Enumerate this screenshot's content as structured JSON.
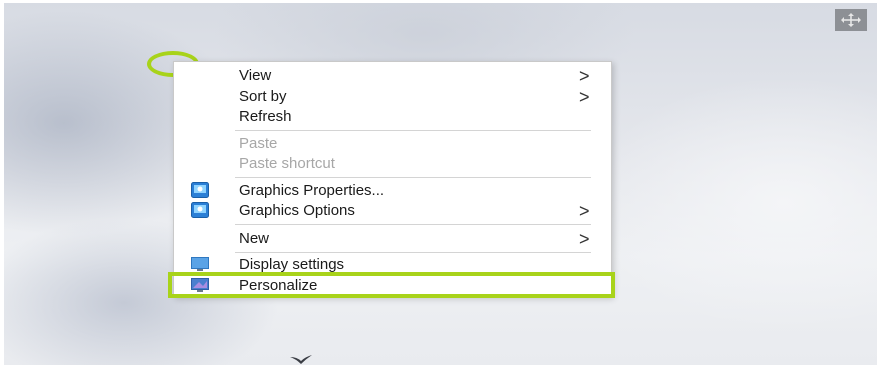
{
  "colors": {
    "highlight": "#a8d31a",
    "menu_background": "#ffffff",
    "disabled_text": "#a7a7a7"
  },
  "icons": {
    "move": "move-arrows-icon",
    "graphics": "intel-graphics-icon",
    "display": "display-monitor-icon",
    "personalize": "personalize-icon",
    "submenu": "chevron-right-icon"
  },
  "context_menu": {
    "view": {
      "label": "View",
      "arrow": ">"
    },
    "sort_by": {
      "label": "Sort by",
      "arrow": ">"
    },
    "refresh": {
      "label": "Refresh"
    },
    "paste": {
      "label": "Paste",
      "disabled": true
    },
    "paste_shortcut": {
      "label": "Paste shortcut",
      "disabled": true
    },
    "graphics_properties": {
      "label": "Graphics Properties..."
    },
    "graphics_options": {
      "label": "Graphics Options",
      "arrow": ">"
    },
    "new": {
      "label": "New",
      "arrow": ">"
    },
    "display_settings": {
      "label": "Display settings"
    },
    "personalize": {
      "label": "Personalize",
      "highlighted": true
    }
  }
}
